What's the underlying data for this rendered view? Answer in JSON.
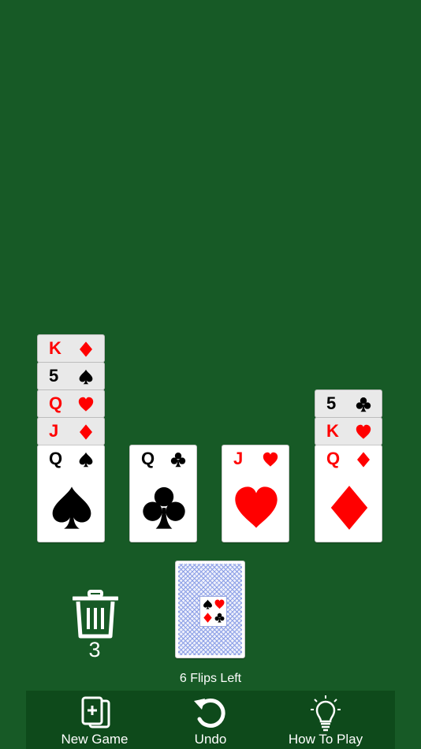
{
  "tableau": [
    {
      "cards": [
        {
          "rank": "K",
          "suit": "diamond",
          "color": "red"
        },
        {
          "rank": "5",
          "suit": "spade",
          "color": "black"
        },
        {
          "rank": "Q",
          "suit": "heart",
          "color": "red"
        },
        {
          "rank": "J",
          "suit": "diamond",
          "color": "red"
        },
        {
          "rank": "Q",
          "suit": "spade",
          "color": "black"
        }
      ]
    },
    {
      "cards": [
        {
          "rank": "Q",
          "suit": "club",
          "color": "black"
        }
      ]
    },
    {
      "cards": [
        {
          "rank": "J",
          "suit": "heart",
          "color": "red"
        }
      ]
    },
    {
      "cards": [
        {
          "rank": "5",
          "suit": "club",
          "color": "black"
        },
        {
          "rank": "K",
          "suit": "heart",
          "color": "red"
        },
        {
          "rank": "Q",
          "suit": "diamond",
          "color": "red"
        }
      ]
    }
  ],
  "discard": {
    "count": "3",
    "icon": "trash-icon"
  },
  "stock": {
    "flips_label": "6 Flips Left",
    "icon": "card-back-icon"
  },
  "toolbar": {
    "new_game": "New Game",
    "undo": "Undo",
    "how_to_play": "How To Play"
  },
  "colors": {
    "felt": "#175a26",
    "toolbar": "#0e4a1b",
    "red": "#ff0000",
    "black": "#000000"
  }
}
